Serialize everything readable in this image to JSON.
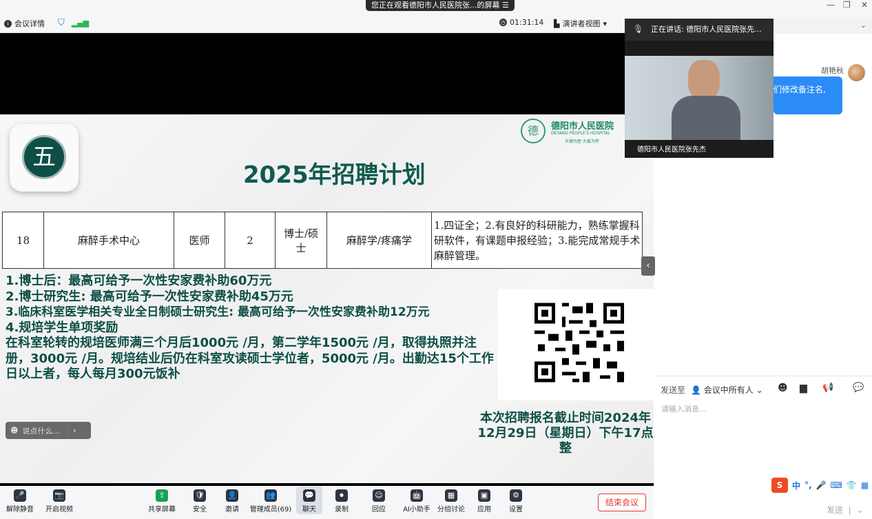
{
  "window": {
    "share_banner": "您正在观看德阳市人民医院张...的屏幕",
    "minimize": "—",
    "restore": "❐",
    "close": "✕"
  },
  "topbar": {
    "meeting_info": "会议详情",
    "timer": "01:31:14",
    "view_mode": "演讲者视图"
  },
  "slide": {
    "section_number": "五",
    "title": "2025年招聘计划",
    "logo_name": "德阳市人民医院",
    "logo_english": "DEYANG PEOPLE'S HOSPITAL",
    "logo_glyph": "德",
    "logo_motto": "大德为医·大爱为怀",
    "job_row": {
      "no": "18",
      "dept": "麻醉手术中心",
      "position": "医师",
      "count": "2",
      "degree": "博士/硕士",
      "major": "麻醉学/疼痛学",
      "requirements": "1.四证全；2.有良好的科研能力，熟练掌握科研软件，有课题申报经验；3.能完成常规手术麻醉管理。"
    },
    "benefits": [
      "1.博士后：最高可给予一次性安家费补助60万元",
      "2.博士研究生: 最高可给予一次性安家费补助45万元",
      "3.临床科室医学相关专业全日制硕士研究生: 最高可给予一次性安家费补助12万元",
      "4.规培学生单项奖励",
      "在科室轮转的规培医师满三个月后1000元 /月，第二学年1500元 /月，取得执照并注册，3000元 /月。规培结业后仍在科室攻读硕士学位者，5000元 /月。出勤达15个工作日以上者，每人每月300元饭补"
    ],
    "deadline": "本次招聘报名截止时间2024年 12月29日（星期日）下午17点整"
  },
  "comment_box": {
    "placeholder": "说点什么..."
  },
  "video": {
    "speaking_label": "正在讲话:",
    "speaking_name": "德阳市人民医院张先...",
    "name_tag": "德阳市人民医院张先杰"
  },
  "chat": {
    "sender": "胡艳秋",
    "message": "们修改备注名,",
    "send_to_label": "发送至",
    "send_to_target": "会议中所有人",
    "input_placeholder": "请输入消息...",
    "send_button": "发送",
    "ime_chars": [
      "中",
      "°,",
      "🎤",
      "⌨",
      "👕",
      "▦"
    ]
  },
  "toolbar": {
    "items": [
      {
        "label": "解除静音",
        "icon": "🎤"
      },
      {
        "label": "开启视频",
        "icon": "📷"
      },
      {
        "label": "共享屏幕",
        "icon": "⇪"
      },
      {
        "label": "安全",
        "icon": "🛡"
      },
      {
        "label": "邀请",
        "icon": "👤"
      },
      {
        "label": "管理成员(69)",
        "icon": "👥"
      },
      {
        "label": "聊天",
        "icon": "💬"
      },
      {
        "label": "录制",
        "icon": "⏺"
      },
      {
        "label": "回应",
        "icon": "☺"
      },
      {
        "label": "AI小助手",
        "icon": "🤖"
      },
      {
        "label": "分组讨论",
        "icon": "▦"
      },
      {
        "label": "应用",
        "icon": "▣"
      },
      {
        "label": "设置",
        "icon": "⚙"
      }
    ],
    "end_meeting": "结束会议"
  },
  "colors": {
    "slide_green": "#0e4f47",
    "accent_blue": "#2b8cf7",
    "end_red": "#e5362f"
  }
}
